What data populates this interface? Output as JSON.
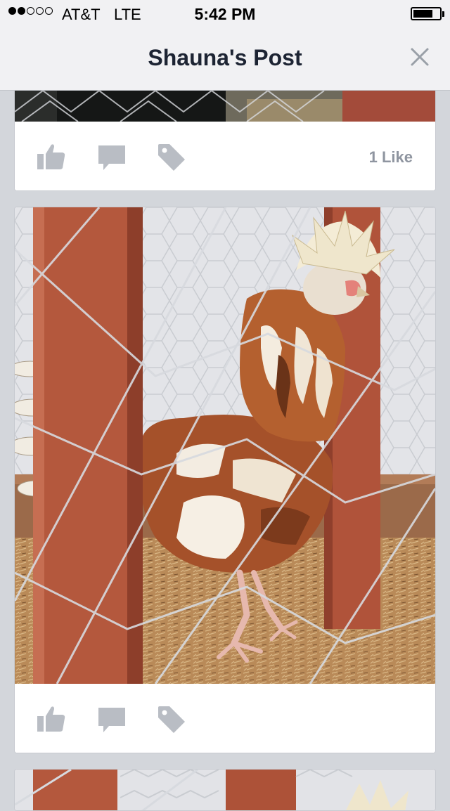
{
  "status_bar": {
    "signal_bars_filled": 2,
    "signal_bars_total": 5,
    "carrier": "AT&T",
    "network": "LTE",
    "time": "5:42 PM",
    "battery_level": 0.75
  },
  "nav": {
    "title": "Shauna's Post",
    "close_icon": "close-icon"
  },
  "posts": [
    {
      "photo_subject": "",
      "actions": [
        "like-icon",
        "comment-icon",
        "tag-icon"
      ],
      "like_count": "1 Like"
    },
    {
      "photo_subject": "",
      "actions": [
        "like-icon",
        "comment-icon",
        "tag-icon"
      ],
      "like_count": ""
    },
    {
      "photo_subject": "",
      "actions": [],
      "like_count": ""
    }
  ],
  "colors": {
    "background": "#d3d6db",
    "nav_bar": "#f1f1f3",
    "title_text": "#1d2433",
    "action_icon": "#b9bdc4",
    "like_count_text": "#8f95a0",
    "post_wood": "#b0533a",
    "chicken_feather": "#a5512a"
  }
}
